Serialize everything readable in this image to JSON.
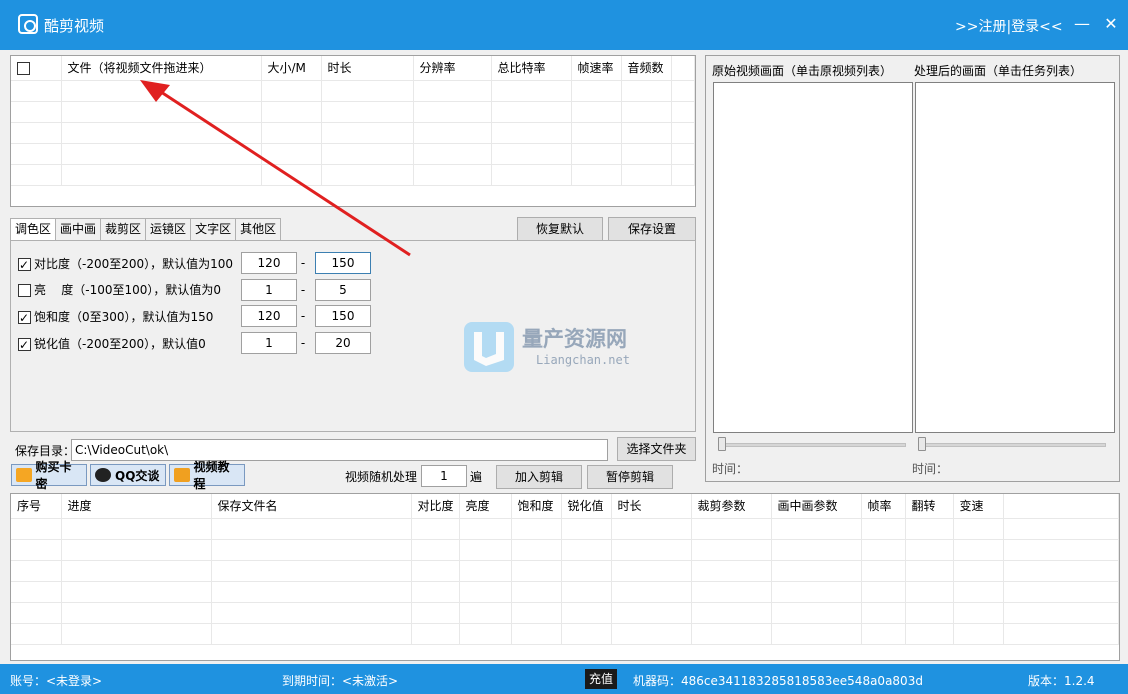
{
  "titlebar": {
    "title": "酷剪视频",
    "login": ">>注册|登录<<",
    "minimize": "—",
    "close": "✕"
  },
  "file_table": {
    "headers": [
      "文件（将视频文件拖进来）",
      "大小/M",
      "时长",
      "分辨率",
      "总比特率",
      "帧速率",
      "音频数"
    ]
  },
  "tabs": [
    "调色区",
    "画中画",
    "裁剪区",
    "运镜区",
    "文字区",
    "其他区"
  ],
  "buttons": {
    "restore": "恢复默认",
    "save_settings": "保存设置",
    "choose_folder": "选择文件夹",
    "add_edit": "加入剪辑",
    "pause_edit": "暂停剪辑"
  },
  "settings": [
    {
      "label": "对比度（-200至200），默认值为100",
      "checked": true,
      "min": "120",
      "max": "150"
    },
    {
      "label": "亮    度（-100至100），默认值为0",
      "checked": false,
      "min": "1",
      "max": "5"
    },
    {
      "label": "饱和度（0至300），默认值为150",
      "checked": true,
      "min": "120",
      "max": "150"
    },
    {
      "label": "锐化值（-200至200），默认值0",
      "checked": true,
      "min": "1",
      "max": "20"
    }
  ],
  "save_dir": {
    "label": "保存目录：",
    "value": "C:\\VideoCut\\ok\\"
  },
  "mini_buttons": {
    "buy": "购买卡密",
    "qq": "QQ交谈",
    "tutorial": "视频教程"
  },
  "random": {
    "label": "视频随机处理",
    "value": "1",
    "unit": "遍"
  },
  "preview": {
    "original": "原始视频画面（单击原视频列表）",
    "processed": "处理后的画面（单击任务列表）",
    "time_label": "时间："
  },
  "task_table": {
    "headers": [
      "序号",
      "进度",
      "保存文件名",
      "对比度",
      "亮度",
      "饱和度",
      "锐化值",
      "时长",
      "裁剪参数",
      "画中画参数",
      "帧率",
      "翻转",
      "变速"
    ]
  },
  "watermark": {
    "title": "量产资源网",
    "sub": "Liangchan.net"
  },
  "status": {
    "account": "账号：<未登录>",
    "expire": "到期时间：<未激活>",
    "recharge": "充值",
    "machine": "机器码：486ce341183285818583ee548a0a803d",
    "version": "版本：1.2.4"
  },
  "colors": {
    "titlebar": "#1f92e0",
    "arrow": "#e02020"
  }
}
